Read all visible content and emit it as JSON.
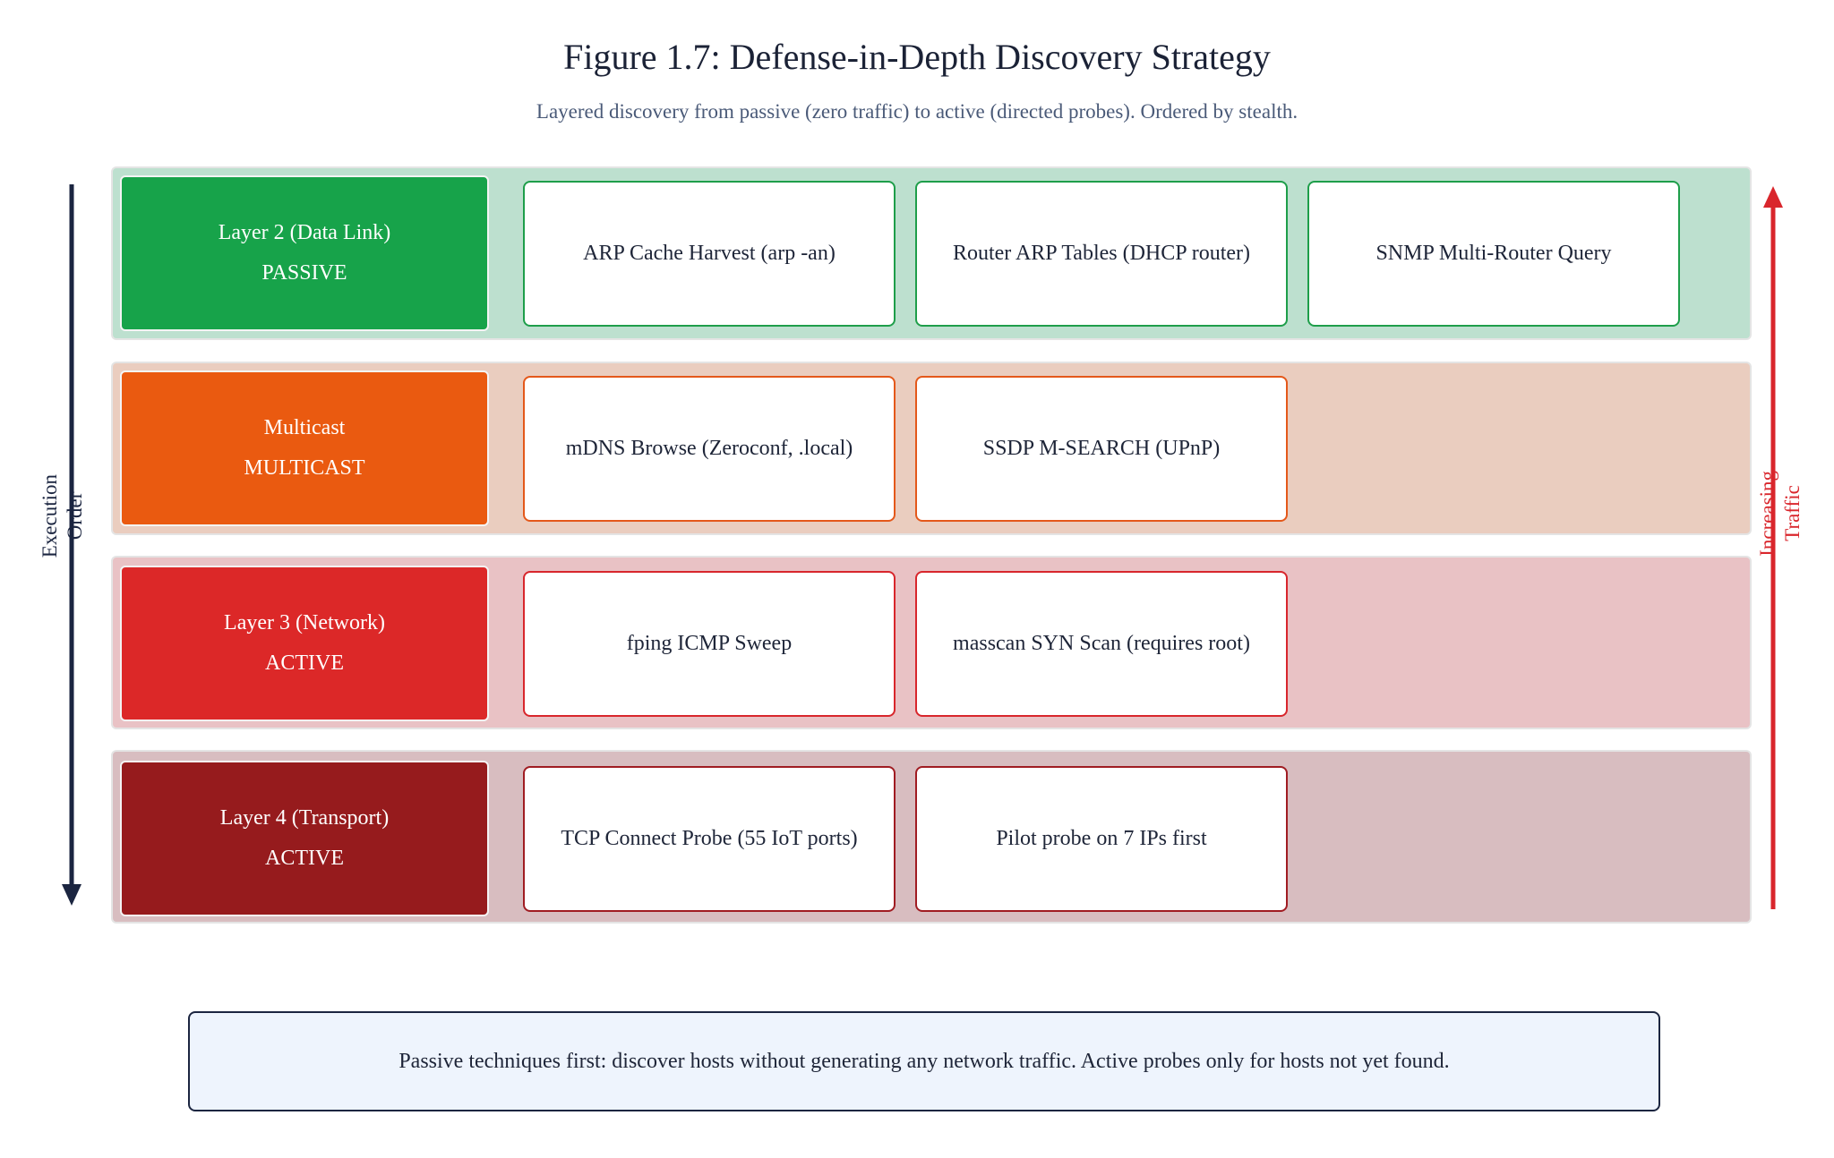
{
  "title": "Figure 1.7: Defense-in-Depth Discovery Strategy",
  "subtitle": "Layered discovery from passive (zero traffic) to active (directed probes). Ordered by stealth.",
  "left_axis": {
    "label_line1": "Execution",
    "label_line2": "Order",
    "color": "#1b2540"
  },
  "right_axis": {
    "label_line1": "Increasing",
    "label_line2": "Traffic",
    "color": "#d9262c"
  },
  "layers": [
    {
      "name": "Layer 2 (Data Link)",
      "mode": "PASSIVE",
      "label_color": "#17a34a",
      "band_color": "#bde0cf",
      "box_border": "#1e9e4a",
      "techniques": [
        "ARP Cache Harvest (arp -an)",
        "Router ARP Tables (DHCP router)",
        "SNMP Multi-Router Query"
      ]
    },
    {
      "name": "Multicast",
      "mode": "MULTICAST",
      "label_color": "#ea5a10",
      "band_color": "#eacdbf",
      "box_border": "#e4581a",
      "techniques": [
        "mDNS Browse (Zeroconf, .local)",
        "SSDP M-SEARCH (UPnP)"
      ]
    },
    {
      "name": "Layer 3 (Network)",
      "mode": "ACTIVE",
      "label_color": "#dc2828",
      "band_color": "#e9c2c5",
      "box_border": "#d8262c",
      "techniques": [
        "fping ICMP Sweep",
        "masscan SYN Scan (requires root)"
      ]
    },
    {
      "name": "Layer 4 (Transport)",
      "mode": "ACTIVE",
      "label_color": "#961b1d",
      "band_color": "#d8bdc0",
      "box_border": "#a01c22",
      "techniques": [
        "TCP Connect Probe (55 IoT ports)",
        "Pilot probe on 7 IPs first"
      ]
    }
  ],
  "summary": "Passive techniques first: discover hosts without generating any network traffic. Active probes only for hosts not yet found."
}
